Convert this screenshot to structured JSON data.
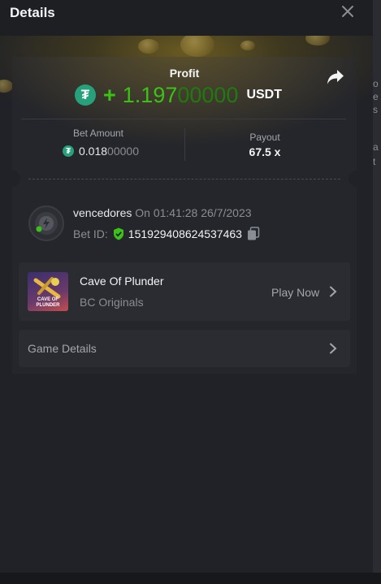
{
  "header": {
    "title": "Details",
    "close_icon": "close-icon"
  },
  "profit": {
    "label": "Profit",
    "currency_icon": "tether-icon",
    "sign": "+",
    "amount_main": "1.197",
    "amount_zeros": "00000",
    "currency": "USDT"
  },
  "bet_amount": {
    "label": "Bet Amount",
    "main": "0.018",
    "zeros": "00000"
  },
  "payout": {
    "label": "Payout",
    "value": "67.5 x"
  },
  "bet_info": {
    "username": "vencedores",
    "on_time": "On 01:41:28 26/7/2023",
    "bet_id_label": "Bet ID:",
    "bet_id": "151929408624537463"
  },
  "game": {
    "name": "Cave Of Plunder",
    "provider": "BC Originals",
    "thumb_text": "CAVE OF PLUNDER",
    "action": "Play Now"
  },
  "game_details": {
    "label": "Game Details"
  },
  "colors": {
    "win_green": "#3bc117",
    "tether_green": "#26a17b",
    "background": "#212227"
  }
}
